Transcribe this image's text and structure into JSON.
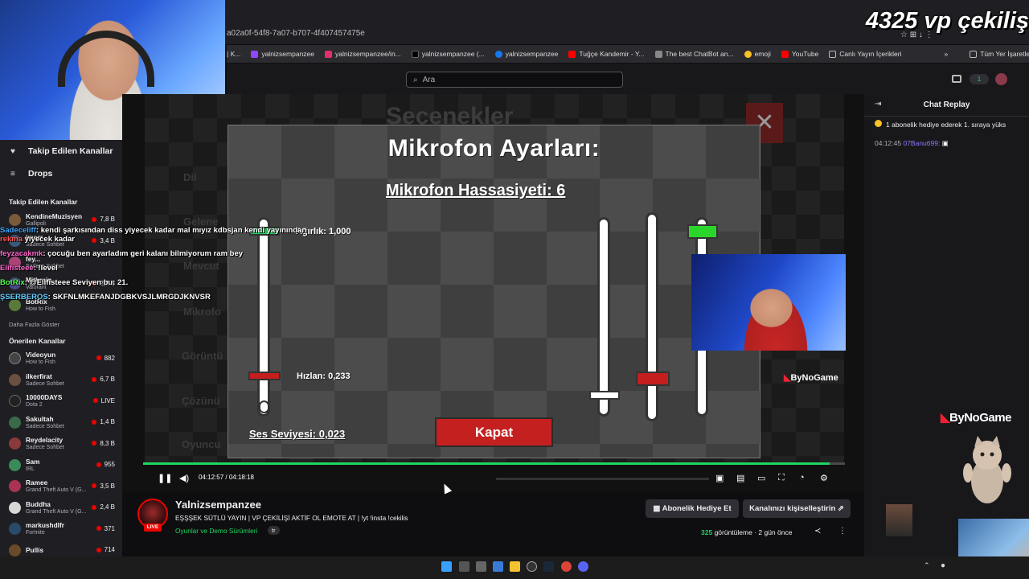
{
  "browser": {
    "url_fragment": "a02a0f-54f8-7a07-b707-4f407457475e",
    "bookmarks": [
      {
        "label": "| K...",
        "color": "#444"
      },
      {
        "label": "yalnizsempanzee",
        "color": "#9146ff"
      },
      {
        "label": "yalnizsempanzee/in...",
        "color": "#e1306c"
      },
      {
        "label": "yalnizsempanzee (...",
        "color": "#000000"
      },
      {
        "label": "yalnizsempanzee",
        "color": "#1877f2"
      },
      {
        "label": "Tuğçe Kandemir - Y...",
        "color": "#ff0000"
      },
      {
        "label": "The best ChatBot an...",
        "color": "#888888"
      },
      {
        "label": "emoji",
        "color": "#f7c325"
      },
      {
        "label": "YouTube",
        "color": "#ff0000"
      },
      {
        "label": "Canlı Yayın İçerikleri",
        "color": "#bbbbbb"
      }
    ],
    "all_bookmarks": "Tüm Yer İşaretleri"
  },
  "overlay": {
    "giveaway": "4325 vp çekiliş"
  },
  "search": {
    "placeholder": "Ara"
  },
  "notifications_count": "1",
  "sidebar": {
    "followed_link": "Takip Edilen Kanallar",
    "drops_link": "Drops",
    "followed_header": "Takip Edilen Kanallar",
    "followed": [
      {
        "name": "KendineMuzisyen",
        "game": "Gallipoli",
        "viewers": "7,8 B",
        "color": "#7a5a3a"
      },
      {
        "name": "imorr",
        "game": "Sadece Sohbet",
        "viewers": "3,4 B",
        "color": "#3a5a7a"
      },
      {
        "name": "fey...",
        "game": "Sadece Sohbet",
        "viewers": "",
        "color": "#aa4477"
      },
      {
        "name": "Mithrain",
        "game": "Valorant",
        "viewers": "2,2 B",
        "color": "#4a4a8a"
      },
      {
        "name": "BotRix",
        "game": "How to Fish",
        "viewers": "",
        "color": "#5a7a3a"
      }
    ],
    "show_more": "Daha Fazla Göster",
    "recommended_header": "Önerilen Kanallar",
    "recommended": [
      {
        "name": "Videoyun",
        "game": "How to Fish",
        "viewers": "882",
        "color": "#2a2a2a"
      },
      {
        "name": "ilkerfirat",
        "game": "Sadece Sohbet",
        "viewers": "6,7 B",
        "color": "#6a5040"
      },
      {
        "name": "10000DAYS",
        "game": "Dota 2",
        "viewers": "LIVE",
        "color": "#222222"
      },
      {
        "name": "Sakultah",
        "game": "Sadece Sohbet",
        "viewers": "1,4 B",
        "color": "#3a6a4a"
      },
      {
        "name": "Reydelacity",
        "game": "Sadece Sohbet",
        "viewers": "8,3 B",
        "color": "#8a3a3a"
      },
      {
        "name": "Sam",
        "game": "IRL",
        "viewers": "955",
        "color": "#3a8a5a"
      },
      {
        "name": "Ramee",
        "game": "Grand Theft Auto V (G...",
        "viewers": "3,5 B",
        "color": "#aa3355"
      },
      {
        "name": "Buddha",
        "game": "Grand Theft Auto V (G...",
        "viewers": "2,4 B",
        "color": "#d8d8d8"
      },
      {
        "name": "markushdlfr",
        "game": "Fortnite",
        "viewers": "371",
        "color": "#2a4a6a"
      },
      {
        "name": "Pullis",
        "game": "",
        "viewers": "714",
        "color": "#6a4a2a"
      }
    ]
  },
  "stream_chat_overlay": [
    {
      "user": "Sadeceliff",
      "color": "#3aa8ff",
      "text": ": kendi şarkısından diss yiyecek kadar mal mıyız kdbsjan kendi yayınından"
    },
    {
      "user": "rekma",
      "color": "#ff5555",
      "text": " yiyecek kadar"
    },
    {
      "user": "feyzacakmk",
      "color": "#ff66cc",
      "text": ": çocuğu ben ayarladım geri kalanı bilmiyorum ram bey"
    },
    {
      "user": "Elifisteee",
      "color": "#ff66cc",
      "text": ": !level"
    },
    {
      "user": "BotRix",
      "color": "#55ff55",
      "text": ": @Elifisteee Seviyen bu: 21."
    },
    {
      "user": "ŞSERBEROS",
      "color": "#66ccff",
      "text": ": SKFNLMKEFANJDGBKVSJLMRGDJKNVSR"
    }
  ],
  "game": {
    "ghost_title": "Seçenekler",
    "ghost_menu": [
      "Dil",
      "Gelene",
      "Mevcut",
      "Mikrofo",
      "Görüntü",
      "Çözünü",
      "Oyuncu"
    ],
    "title": "Mikrofon Ayarları:",
    "sensitivity": "Mikrofon Hassasiyeti: 6",
    "label_top": "Ağırlık: 1,000",
    "label_speed": "Hızlan: 0,233",
    "label_level": "Ses Seviyesi: 0,023",
    "close_button": "Kapat",
    "slider_speed_fraction": 0.233,
    "sound_level_fraction": 0.023
  },
  "webcam_brand": "ByNoGame",
  "player": {
    "current_time": "04:12:57",
    "separator": "/",
    "duration": "04:18:18",
    "progress_fraction": 0.978
  },
  "video": {
    "channel": "Yalnizsempanzee",
    "live_badge": "LIVE",
    "title": "EŞŞŞEK SÜTLÜ YAYIN | VP ÇEKİLİŞİ AKTİF OL EMOTE AT | !yt !insta !cekilis",
    "game": "Oyunlar ve Demo Sürümleri",
    "tag": "tr",
    "gift_button": "Abonelik Hediye Et",
    "customize_button": "Kanalınızı kişiselleştirin",
    "view_count": "325",
    "views_label": "görüntüleme",
    "age": "2 gün önce"
  },
  "chat": {
    "header": "Chat Replay",
    "pinned": "1 abonelik hediye ederek 1. sıraya yüks",
    "message_time": "04:12:45",
    "message_user": "07Banu699:"
  },
  "overlay_brand": "ByNoGame"
}
